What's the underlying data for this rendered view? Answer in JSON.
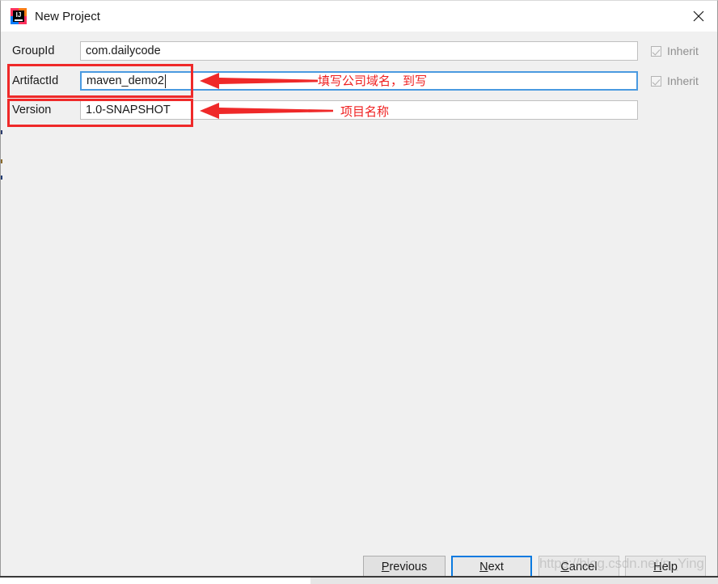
{
  "window": {
    "title": "New Project",
    "app_icon": "intellij-idea-icon",
    "close_icon": "close-icon"
  },
  "form": {
    "rows": [
      {
        "label": "GroupId",
        "value": "com.dailycode",
        "inherit_label": "Inherit",
        "inherit_checked": true,
        "focused": false
      },
      {
        "label": "ArtifactId",
        "value": "maven_demo2",
        "inherit_label": "Inherit",
        "inherit_checked": true,
        "focused": true
      },
      {
        "label": "Version",
        "value": "1.0-SNAPSHOT",
        "inherit_label": "",
        "inherit_checked": false,
        "focused": false
      }
    ]
  },
  "annotations": {
    "color": "#ef2020",
    "notes": [
      {
        "text": "填写公司域名，到写",
        "target": "GroupId"
      },
      {
        "text": "项目名称",
        "target": "ArtifactId"
      }
    ]
  },
  "buttons": [
    {
      "id": "previous",
      "mnemonic": "P",
      "rest": "revious",
      "default": false
    },
    {
      "id": "next",
      "mnemonic": "N",
      "rest": "ext",
      "default": true
    },
    {
      "id": "cancel",
      "mnemonic": "C",
      "rest": "ancel",
      "default": false
    },
    {
      "id": "help",
      "mnemonic": "H",
      "rest": "elp",
      "default": false
    }
  ],
  "watermark": {
    "text": "https://blog.csdn.net/n_Ying"
  },
  "colors": {
    "accent_blue": "#0a7ae0",
    "focus_border": "#4a9ae0",
    "annotation_red": "#ef2020",
    "dialog_bg": "#f0f0f0"
  }
}
